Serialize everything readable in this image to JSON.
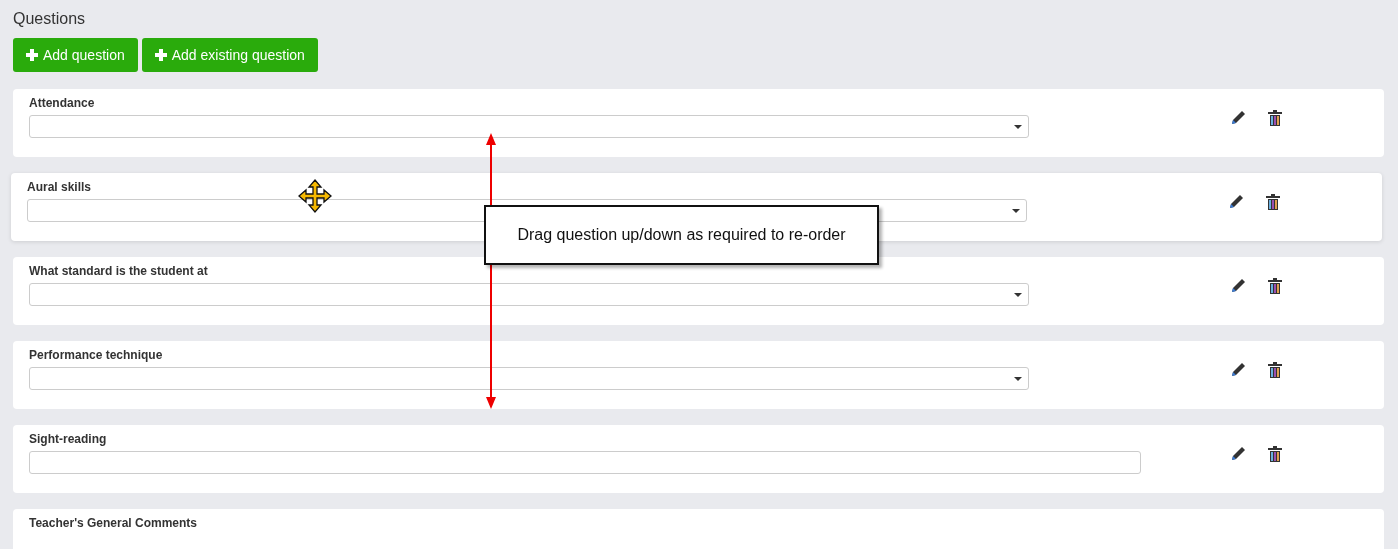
{
  "heading": "Questions",
  "buttons": [
    {
      "label": "Add question"
    },
    {
      "label": "Add existing question"
    }
  ],
  "questions": [
    {
      "title": "Attendance",
      "kind": "select",
      "dragging": false
    },
    {
      "title": "Aural skills",
      "kind": "select",
      "dragging": true
    },
    {
      "title": "What standard is the student at",
      "kind": "select",
      "dragging": false
    },
    {
      "title": "Performance technique",
      "kind": "select",
      "dragging": false
    },
    {
      "title": "Sight-reading",
      "kind": "text",
      "dragging": false
    },
    {
      "title": "Teacher's General Comments",
      "kind": "partial",
      "dragging": false
    }
  ],
  "callout": {
    "text": "Drag question up/down as required to re-order"
  }
}
